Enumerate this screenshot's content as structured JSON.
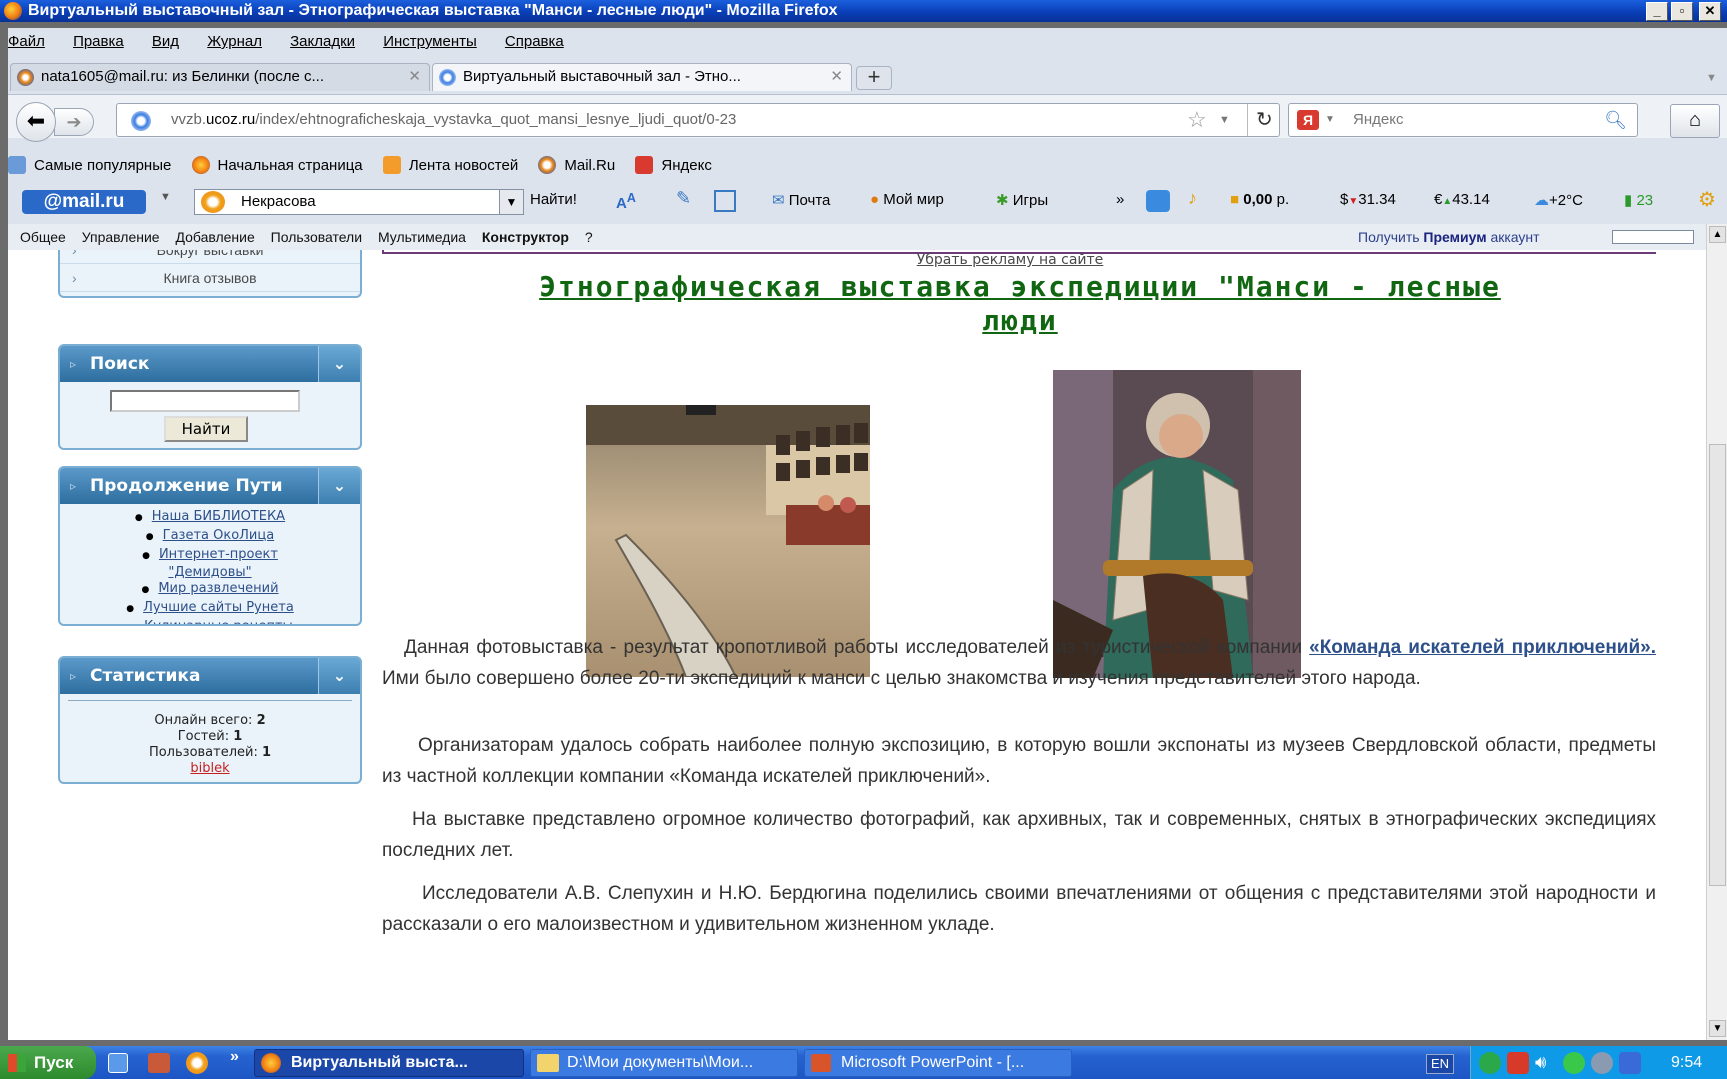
{
  "window": {
    "title": "Виртуальный выставочный зал - Этнографическая выставка \"Манси - лесные люди\" - Mozilla Firefox"
  },
  "menu": [
    "Файл",
    "Правка",
    "Вид",
    "Журнал",
    "Закладки",
    "Инструменты",
    "Справка"
  ],
  "tabs": [
    {
      "label": "nata1605@mail.ru: из Белинки (после с...",
      "active": false
    },
    {
      "label": "Виртуальный выставочный зал - Этно...",
      "active": true
    }
  ],
  "address": {
    "prefix": "vvzb.",
    "domain": "ucoz.ru",
    "path": "/index/ehtnograficheskaja_vystavka_quot_mansi_lesnye_ljudi_quot/0-23"
  },
  "search": {
    "placeholder": "Яндекс"
  },
  "bookmarks": [
    "Самые популярные",
    "Начальная страница",
    "Лента новостей",
    "Mail.Ru",
    "Яндекс"
  ],
  "mailbar": {
    "logo": "@mail.ru",
    "query": "Некрасова",
    "find": "Найти!",
    "mail": "Почта",
    "myworld": "Мой мир",
    "games": "Игры",
    "balance": "0,00",
    "balance_unit": "р.",
    "usd": "31.34",
    "eur": "43.14",
    "weather": "+2°C",
    "traffic": "23"
  },
  "ucoz": {
    "items": [
      "Общее",
      "Управление",
      "Добавление",
      "Пользователи",
      "Мультимедиа",
      "Конструктор",
      "?"
    ],
    "premium_pre": "Получить",
    "premium_bold": "Премиум",
    "premium_post": "аккаунт"
  },
  "sidebar": {
    "top_links": [
      "Вокруг выставки",
      "Книга отзывов"
    ],
    "search": {
      "title": "Поиск",
      "button": "Найти"
    },
    "path": {
      "title": "Продолжение Пути",
      "links": [
        "Наша БИБЛИОТЕКА",
        "Газета ОкоЛица",
        "Интернет-проект",
        "\"Демидовы\"",
        "Мир развлечений",
        "Лучшие сайты Рунета",
        "Кулинарные рецепты"
      ]
    },
    "stats": {
      "title": "Статистика",
      "online_label": "Онлайн всего:",
      "online": "2",
      "guests_label": "Гостей:",
      "guests": "1",
      "users_label": "Пользователей:",
      "users": "1",
      "user": "biblek"
    }
  },
  "main": {
    "remove_ads": "Убрать рекламу на сайте",
    "heading_line1": "Этнографическая выставка экспедиции \"Манси - лесные",
    "heading_line2": "люди",
    "p1_start": "Данная фотовыставка - результат кропотливой  работы  исследователей из туристической компании ",
    "p1_link": "«Команда искателей приключений».",
    "p1_end": " Ими было совершено более 20-ти экспедиций к манси с целью знакомства и изучения представителей этого народа.",
    "p2": "Организаторам удалось собрать наиболее полную экспозицию, в которую вошли  экспонаты из музеев Свердловской области, предметы из частной коллекции компании «Команда искателей приключений».",
    "p3": "На выставке представлено огромное количество фотографий, как архивных, так и современных, снятых в этнографических экспедициях последних лет.",
    "p4": "Исследователи А.В. Слепухин и Н.Ю. Бердюгина  поделились своими впечатлениями от общения с представителями этой народности и  рассказали о его малоизвестном и удивительном жизненном укладе."
  },
  "taskbar": {
    "start": "Пуск",
    "items": [
      "Виртуальный выста...",
      "D:\\Мои документы\\Мои...",
      "Microsoft PowerPoint - [..."
    ],
    "lang": "EN",
    "clock": "9:54"
  }
}
